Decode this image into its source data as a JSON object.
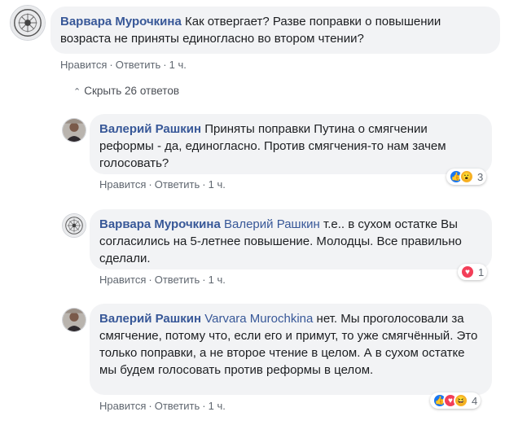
{
  "toggle": {
    "icon": "chevron-up-icon",
    "label": "Скрыть 26 ответов"
  },
  "actions": {
    "like": "Нравится",
    "reply": "Ответить",
    "dot": "·"
  },
  "colors": {
    "author": "#385898",
    "bubble": "#f2f3f5",
    "like": "#1877f2",
    "love": "#f33e58",
    "wow": "#f7b125"
  },
  "comments": [
    {
      "author": "Варвара Мурочкина",
      "mention": "",
      "text": "Как отвергает? Разве поправки о повышении возраста не приняты единогласно во втором чтении?",
      "time": "1 ч.",
      "reactions": [],
      "reaction_count": ""
    },
    {
      "author": "Валерий Рашкин",
      "mention": "",
      "text": "Приняты поправки Путина о смягчении реформы - да, единогласно. Против смягчения-то нам зачем голосовать?",
      "time": "1 ч.",
      "reactions": [
        "like",
        "wow"
      ],
      "reaction_count": "3"
    },
    {
      "author": "Варвара Мурочкина",
      "mention": "Валерий Рашкин",
      "text": "т.е.. в сухом остатке Вы согласились на 5-летнее повышение. Молодцы. Все правильно сделали.",
      "time": "1 ч.",
      "reactions": [
        "love"
      ],
      "reaction_count": "1"
    },
    {
      "author": "Валерий Рашкин",
      "mention": "Varvara Murochkina",
      "text": "нет. Мы проголосовали за смягчение, потому что, если его и примут, то уже смягчённый. Это только поправки, а не второе чтение в целом. А в сухом остатке мы будем голосовать против реформы в целом.",
      "time": "1 ч.",
      "reactions": [
        "like",
        "love",
        "haha"
      ],
      "reaction_count": "4"
    }
  ]
}
